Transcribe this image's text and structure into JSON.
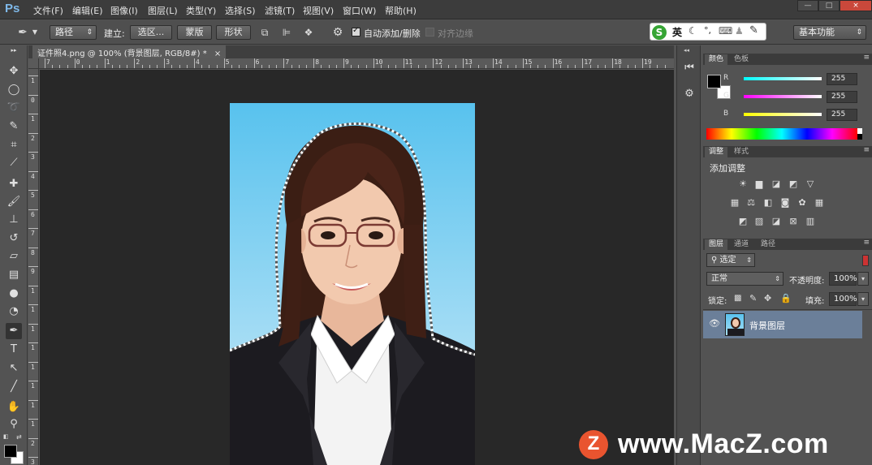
{
  "app": {
    "logo": "Ps"
  },
  "menu": [
    "文件(F)",
    "编辑(E)",
    "图像(I)",
    "图层(L)",
    "类型(Y)",
    "选择(S)",
    "滤镜(T)",
    "视图(V)",
    "窗口(W)",
    "帮助(H)"
  ],
  "window_controls": {
    "minimize": "—",
    "restore": "□",
    "close": "×"
  },
  "options": {
    "tool_mode": "路径",
    "make_label": "建立:",
    "selection_btn": "选区...",
    "mask_btn": "蒙版",
    "shape_btn": "形状",
    "auto_add_delete": "自动添加/删除",
    "auto_add_delete_checked": true,
    "align_edges": "对齐边缘",
    "align_edges_checked": false,
    "ime_lang": "英",
    "workspace": "基本功能"
  },
  "document": {
    "tab_title": "证件照4.png @ 100% (背景图层, RGB/8#) *",
    "close": "×",
    "ruler_top": [
      "7",
      "0",
      "1",
      "2",
      "3",
      "4",
      "5",
      "6",
      "7",
      "8",
      "9",
      "10",
      "11",
      "12",
      "13",
      "14",
      "15",
      "16",
      "17",
      "18",
      "19"
    ],
    "ruler_left": [
      "1",
      "0",
      "1",
      "2",
      "3",
      "4",
      "5",
      "6",
      "7",
      "8",
      "9",
      "1",
      "1",
      "1",
      "1",
      "1",
      "1",
      "1",
      "1",
      "2",
      "3"
    ]
  },
  "color_panel": {
    "tabs": [
      "颜色",
      "色板"
    ],
    "r_label": "R",
    "r": "255",
    "g_label": "G",
    "g": "255",
    "b_label": "B",
    "b": "255",
    "foreground": "#000000",
    "background": "#ffffff"
  },
  "adjust_panel": {
    "tabs": [
      "调整",
      "样式"
    ],
    "title": "添加调整"
  },
  "layers_panel": {
    "tabs": [
      "图层",
      "通道",
      "路径"
    ],
    "filter": "选定",
    "blend_mode": "正常",
    "opacity_label": "不透明度:",
    "opacity": "100%",
    "lock_label": "锁定:",
    "fill_label": "填充:",
    "fill": "100%",
    "layers": [
      {
        "name": "背景图层",
        "visible": true,
        "selected": true
      }
    ]
  },
  "watermark": {
    "logo": "Z",
    "text": "www.MacZ.com"
  },
  "colors": {
    "accent_selected_layer": "#6b7f99",
    "ps_blue": "#7fb9ea",
    "watermark_logo": "#e9542f"
  }
}
